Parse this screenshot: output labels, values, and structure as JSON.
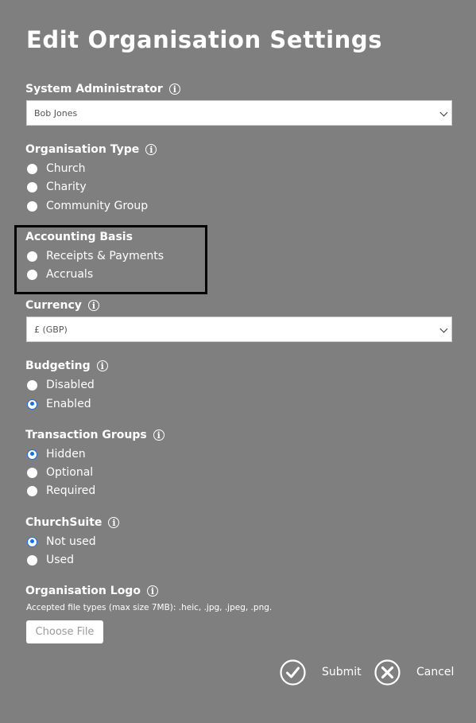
{
  "form": {
    "title": "Edit Organisation Settings"
  },
  "system_admin": {
    "label": "System Administrator",
    "selected": "Bob Jones"
  },
  "organisation_type": {
    "label": "Organisation Type",
    "options": [
      "Church",
      "Charity",
      "Community Group"
    ]
  },
  "accounting_basis": {
    "label": "Accounting Basis",
    "options": [
      "Receipts & Payments",
      "Accruals"
    ]
  },
  "currency": {
    "label": "Currency",
    "selected": "£ (GBP)"
  },
  "budgeting": {
    "label": "Budgeting",
    "options": [
      "Disabled",
      "Enabled"
    ],
    "selected": "Enabled"
  },
  "transaction_groups": {
    "label": "Transaction Groups",
    "options": [
      "Hidden",
      "Optional",
      "Required"
    ],
    "selected": "Hidden"
  },
  "churchsuite": {
    "label": "ChurchSuite",
    "options": [
      "Not used",
      "Used"
    ],
    "selected": "Not used"
  },
  "organisation_logo": {
    "label": "Organisation Logo",
    "hint": "Accepted file types (max size 7MB): .heic, .jpg, .jpeg, .png.",
    "button_label": "Choose File"
  },
  "actions": {
    "submit_label": "Submit",
    "cancel_label": "Cancel"
  },
  "icons": {
    "info": "info-icon",
    "submit": "check-circle-icon",
    "cancel": "close-circle-icon",
    "select_arrow": "chevron-down-icon"
  },
  "colors": {
    "background": "#7f7f7f",
    "text": "#ffffff",
    "radio_accent": "#1a6fd6",
    "highlight_border": "#000000"
  }
}
